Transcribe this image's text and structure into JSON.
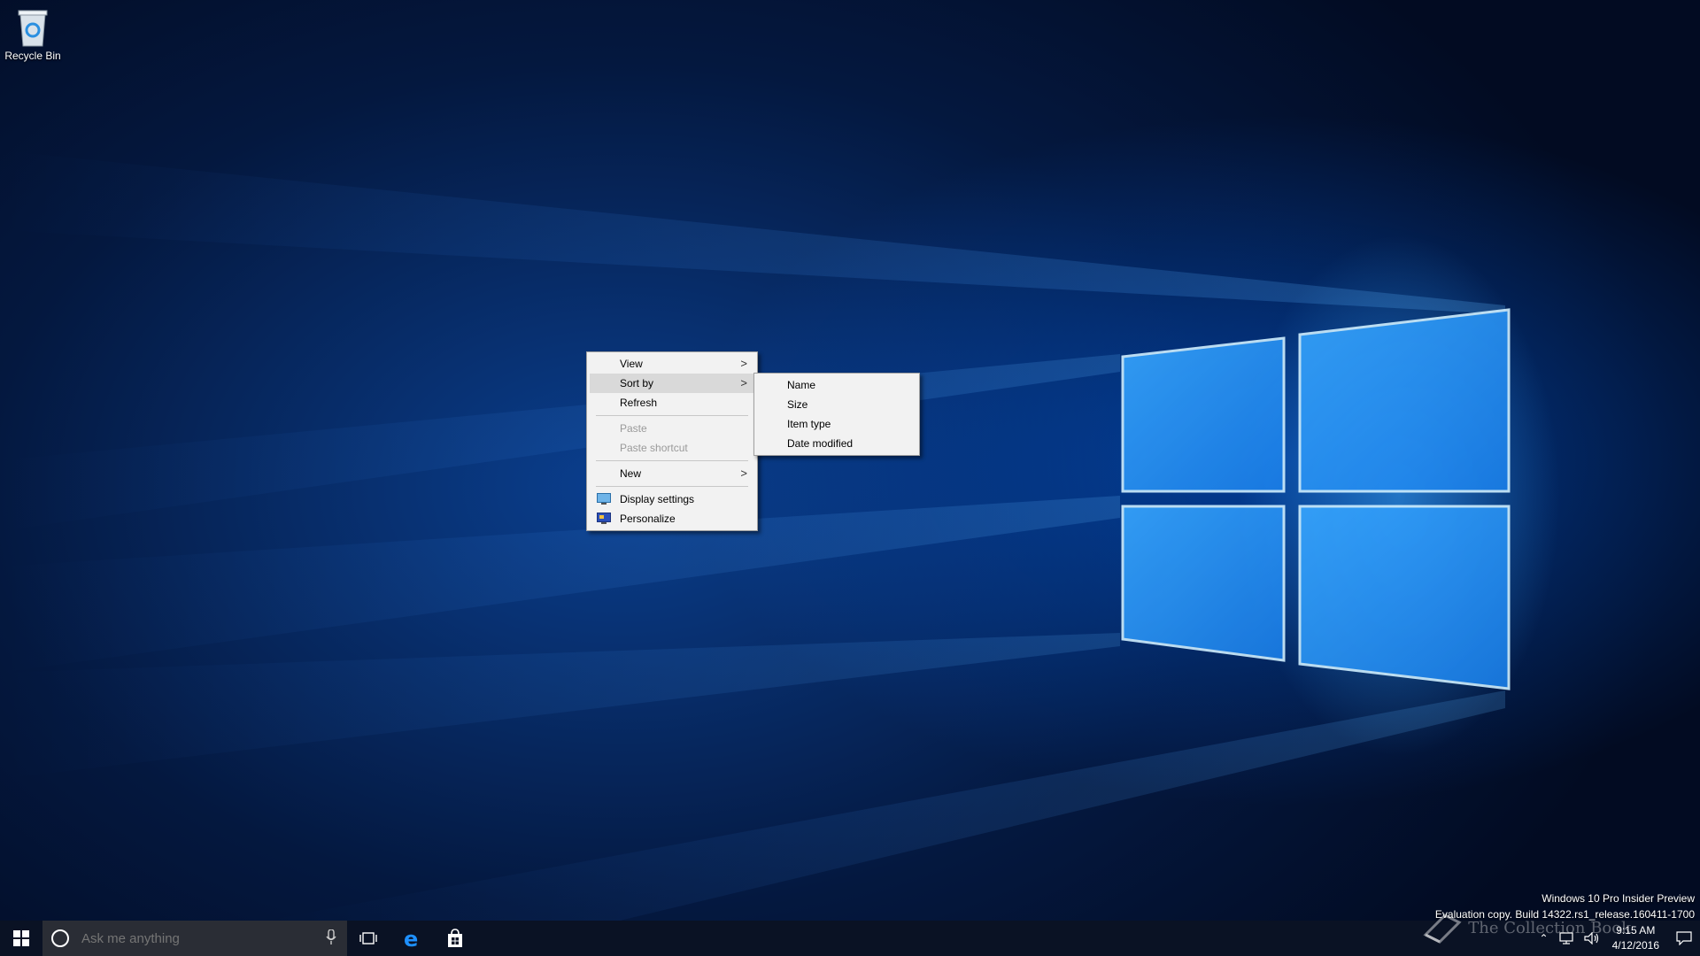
{
  "desktop": {
    "icons": [
      {
        "label": "Recycle Bin",
        "icon": "recycle-bin-icon"
      }
    ],
    "watermark": {
      "line1": "Windows 10 Pro Insider Preview",
      "line2": "Evaluation copy. Build 14322.rs1_release.160411-1700"
    },
    "brand_overlay": "The Collection Book"
  },
  "context_menu": {
    "items": [
      {
        "label": "View",
        "submenu": true
      },
      {
        "label": "Sort by",
        "submenu": true,
        "highlighted": true
      },
      {
        "label": "Refresh"
      },
      {
        "label": "Paste",
        "disabled": true
      },
      {
        "label": "Paste shortcut",
        "disabled": true
      },
      {
        "label": "New",
        "submenu": true
      },
      {
        "label": "Display settings",
        "icon": "display-settings-icon"
      },
      {
        "label": "Personalize",
        "icon": "personalize-icon"
      }
    ]
  },
  "sort_submenu": {
    "items": [
      {
        "label": "Name"
      },
      {
        "label": "Size"
      },
      {
        "label": "Item type"
      },
      {
        "label": "Date modified"
      }
    ]
  },
  "taskbar": {
    "search_placeholder": "Ask me anything",
    "clock": {
      "time": "9:15 AM",
      "date": "4/12/2016"
    },
    "pinned": [
      "task-view-icon",
      "edge-icon",
      "store-icon"
    ]
  },
  "colors": {
    "menu_bg": "#f2f2f2",
    "menu_highlight": "#d9d9d9",
    "taskbar_bg": "#0a1224",
    "search_bg": "#2a2d35",
    "accent": "#1e90ff"
  }
}
